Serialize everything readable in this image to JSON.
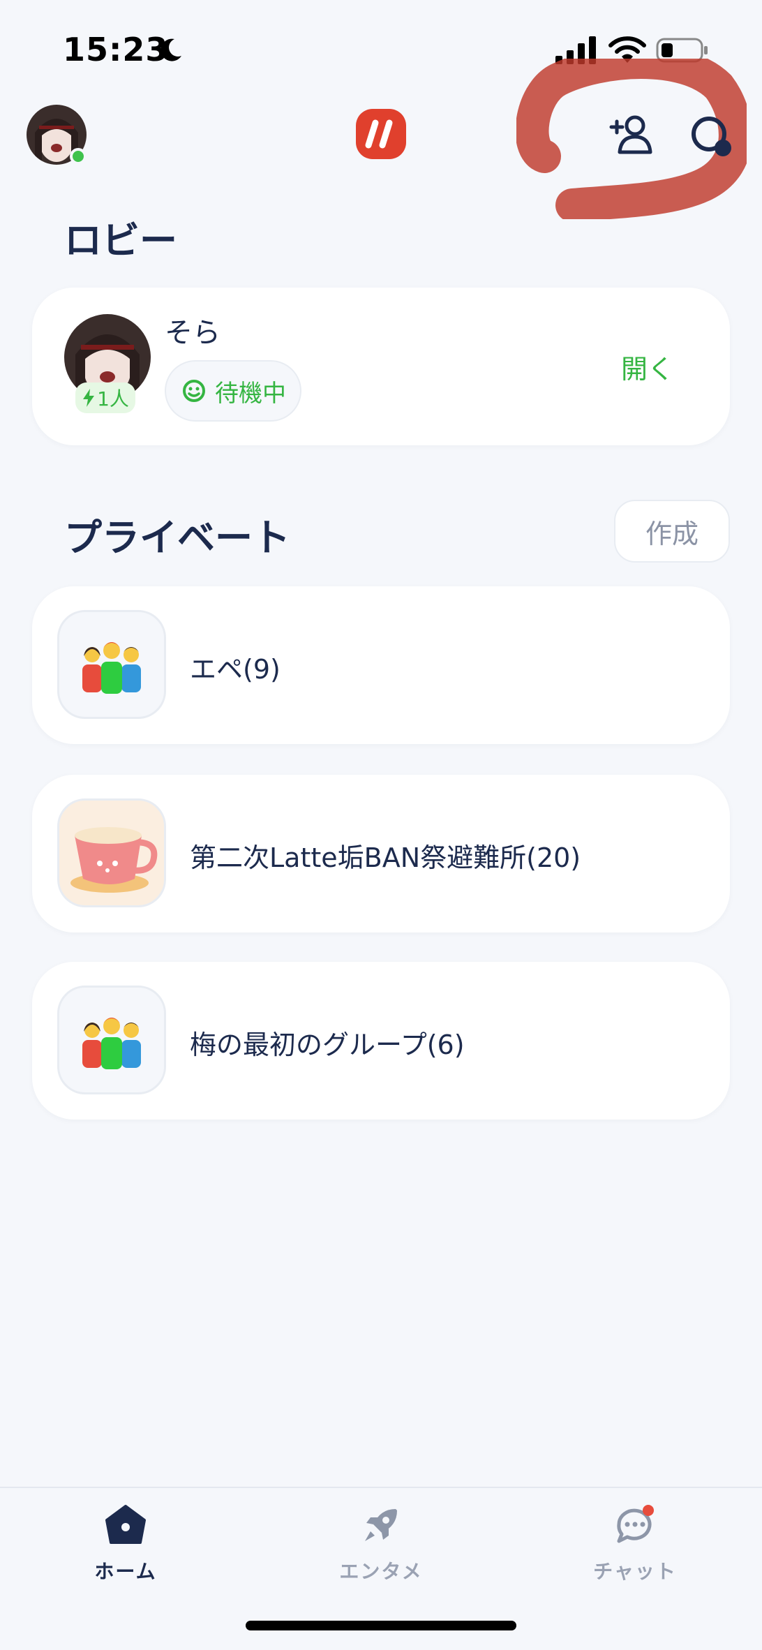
{
  "status_bar": {
    "time": "15:23"
  },
  "lobby": {
    "title": "ロビー",
    "card": {
      "name": "そら",
      "member_count": "1人",
      "status": "待機中",
      "open_label": "開く"
    }
  },
  "private": {
    "title": "プライベート",
    "create_label": "作成",
    "groups": [
      {
        "name": "エペ(9)",
        "icon": "people-group-icon"
      },
      {
        "name": "第二次Latte垢BAN祭避難所(20)",
        "icon": "coffee-cup-icon"
      },
      {
        "name": "梅の最初のグループ(6)",
        "icon": "people-group-icon"
      }
    ]
  },
  "bottom_nav": {
    "items": [
      {
        "label": "ホーム",
        "icon": "home-icon",
        "active": true
      },
      {
        "label": "エンタメ",
        "icon": "rocket-icon",
        "active": false
      },
      {
        "label": "チャット",
        "icon": "chat-icon",
        "active": false
      }
    ]
  },
  "colors": {
    "background": "#f5f7fb",
    "text": "#1c2a4d",
    "accent_green": "#35b542",
    "logo_red": "#e0402d",
    "scribble": "#c0392b"
  }
}
